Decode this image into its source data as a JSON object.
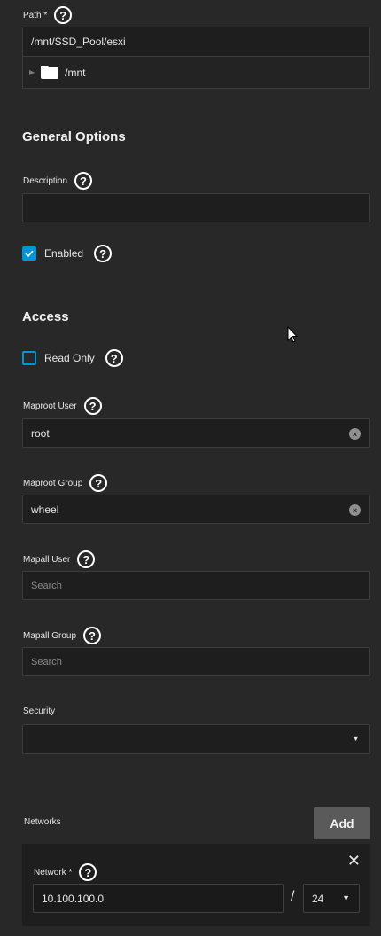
{
  "path": {
    "label": "Path *",
    "value": "/mnt/SSD_Pool/esxi",
    "tree_item": "/mnt"
  },
  "general_options": {
    "title": "General Options",
    "description_label": "Description",
    "description_value": "",
    "enabled_label": "Enabled",
    "enabled_checked": true
  },
  "access": {
    "title": "Access",
    "read_only_label": "Read Only",
    "read_only_checked": false,
    "maproot_user_label": "Maproot User",
    "maproot_user_value": "root",
    "maproot_group_label": "Maproot Group",
    "maproot_group_value": "wheel",
    "mapall_user_label": "Mapall User",
    "mapall_user_placeholder": "Search",
    "mapall_group_label": "Mapall Group",
    "mapall_group_placeholder": "Search",
    "security_label": "Security",
    "security_value": ""
  },
  "networks": {
    "label": "Networks",
    "add_label": "Add",
    "network_label": "Network *",
    "network_value": "10.100.100.0",
    "separator": "/",
    "mask_value": "24"
  },
  "icons": {
    "help": "?",
    "clear": "×",
    "close": "✕",
    "expand": "▶",
    "dropdown": "▼"
  },
  "colors": {
    "accent": "#0095d5",
    "background": "#282828",
    "input_bg": "#1e1e1e"
  }
}
